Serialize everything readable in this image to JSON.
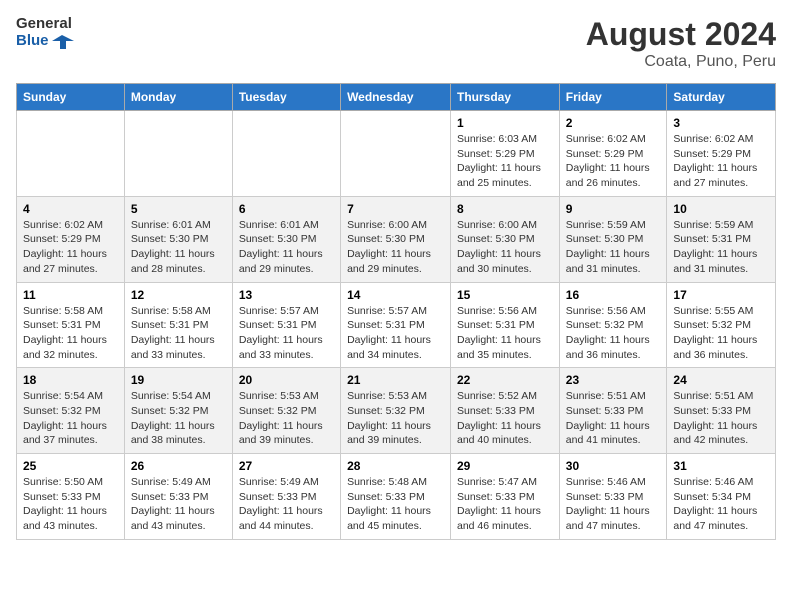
{
  "header": {
    "logo_line1": "General",
    "logo_line2": "Blue",
    "main_title": "August 2024",
    "subtitle": "Coata, Puno, Peru"
  },
  "days_of_week": [
    "Sunday",
    "Monday",
    "Tuesday",
    "Wednesday",
    "Thursday",
    "Friday",
    "Saturday"
  ],
  "weeks": [
    [
      {
        "date": "",
        "info": ""
      },
      {
        "date": "",
        "info": ""
      },
      {
        "date": "",
        "info": ""
      },
      {
        "date": "",
        "info": ""
      },
      {
        "date": "1",
        "info": "Sunrise: 6:03 AM\nSunset: 5:29 PM\nDaylight: 11 hours and 25 minutes."
      },
      {
        "date": "2",
        "info": "Sunrise: 6:02 AM\nSunset: 5:29 PM\nDaylight: 11 hours and 26 minutes."
      },
      {
        "date": "3",
        "info": "Sunrise: 6:02 AM\nSunset: 5:29 PM\nDaylight: 11 hours and 27 minutes."
      }
    ],
    [
      {
        "date": "4",
        "info": "Sunrise: 6:02 AM\nSunset: 5:29 PM\nDaylight: 11 hours and 27 minutes."
      },
      {
        "date": "5",
        "info": "Sunrise: 6:01 AM\nSunset: 5:30 PM\nDaylight: 11 hours and 28 minutes."
      },
      {
        "date": "6",
        "info": "Sunrise: 6:01 AM\nSunset: 5:30 PM\nDaylight: 11 hours and 29 minutes."
      },
      {
        "date": "7",
        "info": "Sunrise: 6:00 AM\nSunset: 5:30 PM\nDaylight: 11 hours and 29 minutes."
      },
      {
        "date": "8",
        "info": "Sunrise: 6:00 AM\nSunset: 5:30 PM\nDaylight: 11 hours and 30 minutes."
      },
      {
        "date": "9",
        "info": "Sunrise: 5:59 AM\nSunset: 5:30 PM\nDaylight: 11 hours and 31 minutes."
      },
      {
        "date": "10",
        "info": "Sunrise: 5:59 AM\nSunset: 5:31 PM\nDaylight: 11 hours and 31 minutes."
      }
    ],
    [
      {
        "date": "11",
        "info": "Sunrise: 5:58 AM\nSunset: 5:31 PM\nDaylight: 11 hours and 32 minutes."
      },
      {
        "date": "12",
        "info": "Sunrise: 5:58 AM\nSunset: 5:31 PM\nDaylight: 11 hours and 33 minutes."
      },
      {
        "date": "13",
        "info": "Sunrise: 5:57 AM\nSunset: 5:31 PM\nDaylight: 11 hours and 33 minutes."
      },
      {
        "date": "14",
        "info": "Sunrise: 5:57 AM\nSunset: 5:31 PM\nDaylight: 11 hours and 34 minutes."
      },
      {
        "date": "15",
        "info": "Sunrise: 5:56 AM\nSunset: 5:31 PM\nDaylight: 11 hours and 35 minutes."
      },
      {
        "date": "16",
        "info": "Sunrise: 5:56 AM\nSunset: 5:32 PM\nDaylight: 11 hours and 36 minutes."
      },
      {
        "date": "17",
        "info": "Sunrise: 5:55 AM\nSunset: 5:32 PM\nDaylight: 11 hours and 36 minutes."
      }
    ],
    [
      {
        "date": "18",
        "info": "Sunrise: 5:54 AM\nSunset: 5:32 PM\nDaylight: 11 hours and 37 minutes."
      },
      {
        "date": "19",
        "info": "Sunrise: 5:54 AM\nSunset: 5:32 PM\nDaylight: 11 hours and 38 minutes."
      },
      {
        "date": "20",
        "info": "Sunrise: 5:53 AM\nSunset: 5:32 PM\nDaylight: 11 hours and 39 minutes."
      },
      {
        "date": "21",
        "info": "Sunrise: 5:53 AM\nSunset: 5:32 PM\nDaylight: 11 hours and 39 minutes."
      },
      {
        "date": "22",
        "info": "Sunrise: 5:52 AM\nSunset: 5:33 PM\nDaylight: 11 hours and 40 minutes."
      },
      {
        "date": "23",
        "info": "Sunrise: 5:51 AM\nSunset: 5:33 PM\nDaylight: 11 hours and 41 minutes."
      },
      {
        "date": "24",
        "info": "Sunrise: 5:51 AM\nSunset: 5:33 PM\nDaylight: 11 hours and 42 minutes."
      }
    ],
    [
      {
        "date": "25",
        "info": "Sunrise: 5:50 AM\nSunset: 5:33 PM\nDaylight: 11 hours and 43 minutes."
      },
      {
        "date": "26",
        "info": "Sunrise: 5:49 AM\nSunset: 5:33 PM\nDaylight: 11 hours and 43 minutes."
      },
      {
        "date": "27",
        "info": "Sunrise: 5:49 AM\nSunset: 5:33 PM\nDaylight: 11 hours and 44 minutes."
      },
      {
        "date": "28",
        "info": "Sunrise: 5:48 AM\nSunset: 5:33 PM\nDaylight: 11 hours and 45 minutes."
      },
      {
        "date": "29",
        "info": "Sunrise: 5:47 AM\nSunset: 5:33 PM\nDaylight: 11 hours and 46 minutes."
      },
      {
        "date": "30",
        "info": "Sunrise: 5:46 AM\nSunset: 5:33 PM\nDaylight: 11 hours and 47 minutes."
      },
      {
        "date": "31",
        "info": "Sunrise: 5:46 AM\nSunset: 5:34 PM\nDaylight: 11 hours and 47 minutes."
      }
    ]
  ]
}
